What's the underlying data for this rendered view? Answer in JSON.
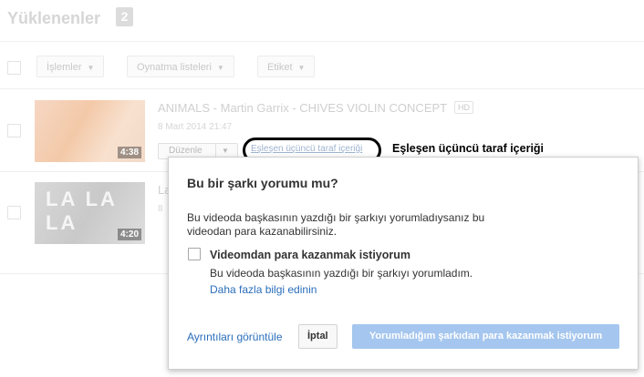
{
  "header": {
    "title": "Yüklenenler",
    "count": "2"
  },
  "toolbar": {
    "actions_label": "İşlemler",
    "playlists_label": "Oynatma listeleri",
    "tags_label": "Etiket"
  },
  "videos": [
    {
      "title": "ANIMALS - Martin Garrix - CHIVES VIOLIN CONCEPT",
      "hd": "HD",
      "date": "8 Mart 2014 21:47",
      "duration": "4:38",
      "edit_label": "Düzenle",
      "third_party_link": "Eşleşen üçüncü taraf içeriği"
    },
    {
      "title": "La",
      "date": "8",
      "duration": "4:20",
      "thumb_text": "LA LA LA"
    }
  ],
  "annotation": {
    "callout": "Eşleşen üçüncü taraf içeriği"
  },
  "dialog": {
    "title": "Bu bir şarkı yorumu mu?",
    "description": "Bu videoda başkasının yazdığı bir şarkıyı yorumladıysanız bu videodan para kazanabilirsiniz.",
    "option_label": "Videomdan para kazanmak istiyorum",
    "option_help": "Bu videoda başkasının yazdığı bir şarkıyı yorumladım.",
    "learn_more": "Daha fazla bilgi edinin",
    "details_link": "Ayrıntıları görüntüle",
    "cancel": "İptal",
    "confirm": "Yorumladığım şarkıdan para kazanmak istiyorum"
  },
  "colors": {
    "link": "#2a6ebb",
    "primary_disabled": "#a5c6ee"
  }
}
